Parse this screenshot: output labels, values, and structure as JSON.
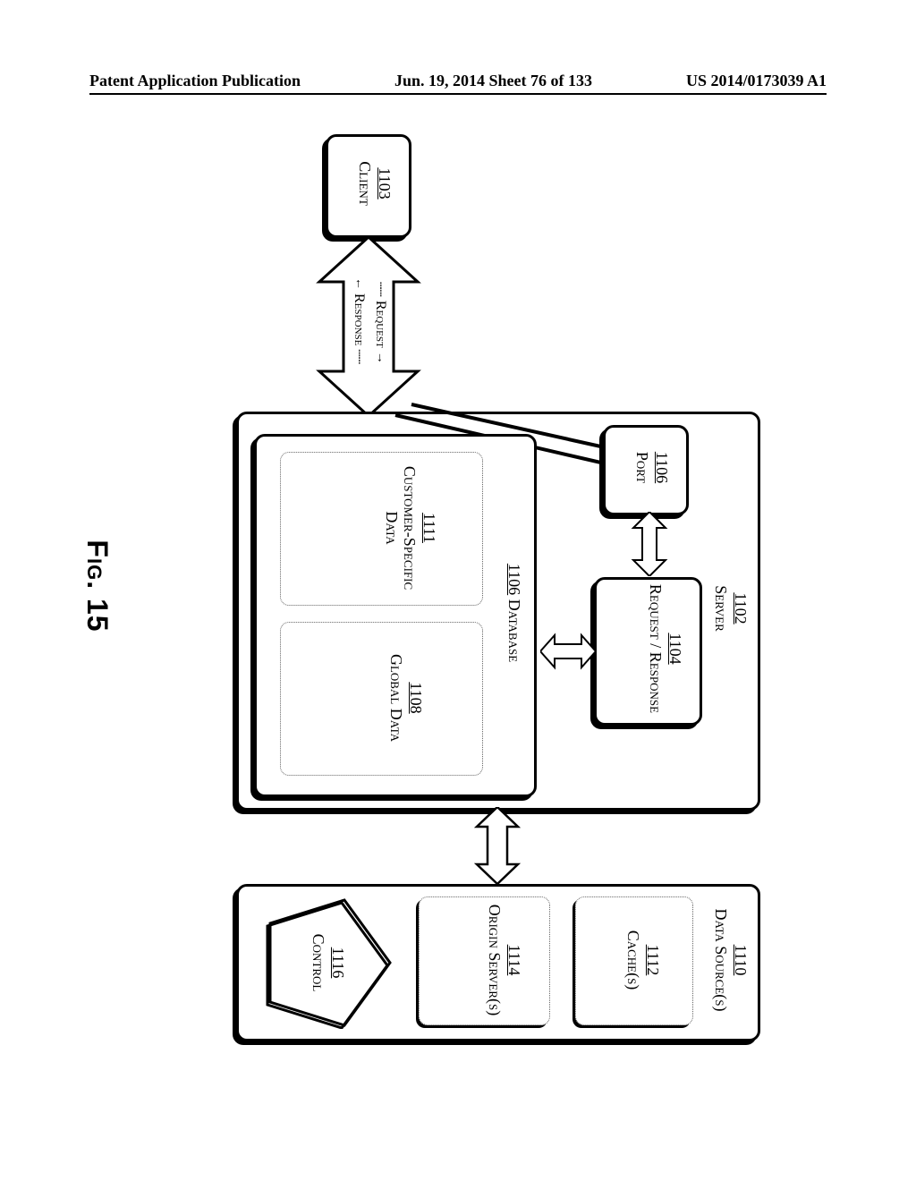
{
  "header": {
    "left": "Patent Application Publication",
    "center": "Jun. 19, 2014  Sheet 76 of 133",
    "right": "US 2014/0173039 A1"
  },
  "figure": {
    "title": "Fig. 15",
    "client": {
      "num": "1103",
      "label": "Client"
    },
    "bigarrow": {
      "request": "Request",
      "response": "Response"
    },
    "server": {
      "num": "1102",
      "label": "Server",
      "port": {
        "num": "1106",
        "label": "Port"
      },
      "reqres": {
        "num": "1104",
        "label": "Request / Response"
      },
      "database": {
        "num": "1106",
        "label": "Database",
        "cust": {
          "num": "1111",
          "label": "Customer-Specific Data"
        },
        "global": {
          "num": "1108",
          "label": "Global Data"
        }
      }
    },
    "datasource": {
      "num": "1110",
      "label": "Data Source(s)",
      "cache": {
        "num": "1112",
        "label": "Cache(s)"
      },
      "origin": {
        "num": "1114",
        "label": "Origin Server(s)"
      },
      "control": {
        "num": "1116",
        "label": "Control"
      }
    }
  }
}
